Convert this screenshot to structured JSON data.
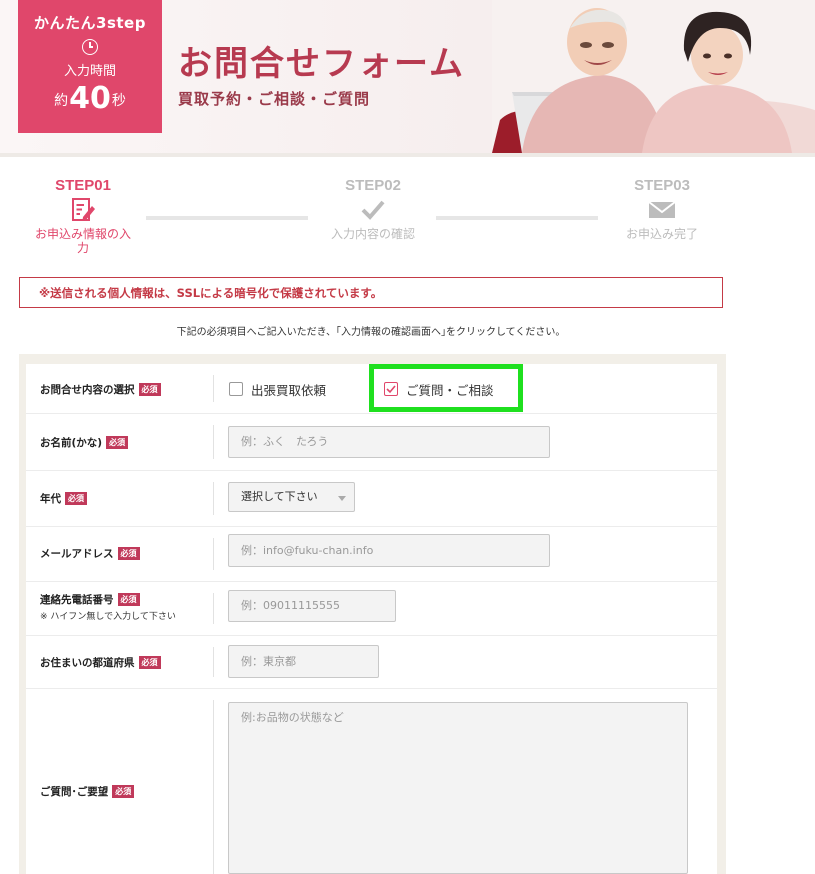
{
  "header": {
    "badge": {
      "steps": "かんたん3step",
      "input_time_label": "入力時間",
      "duration_prefix": "約",
      "duration_value": "40",
      "duration_suffix": "秒"
    },
    "title": "お問合せフォーム",
    "subtitle": "買取予約・ご相談・ご質問"
  },
  "steps": [
    {
      "label": "STEP01",
      "desc": "お申込み情報の入力",
      "status": "active",
      "icon": "edit-icon"
    },
    {
      "label": "STEP02",
      "desc": "入力内容の確認",
      "status": "inactive",
      "icon": "check-icon"
    },
    {
      "label": "STEP03",
      "desc": "お申込み完了",
      "status": "inactive",
      "icon": "mail-icon"
    }
  ],
  "notice": "※送信される個人情報は、SSLによる暗号化で保護されています。",
  "instruction": "下記の必須項目へご記入いただき、｢入力情報の確認画面へ｣をクリックしてください。",
  "required_badge": "必須",
  "form": {
    "inquiry_type": {
      "label": "お問合せ内容の選択",
      "options": [
        {
          "label": "出張買取依頼",
          "checked": false
        },
        {
          "label": "ご質問・ご相談",
          "checked": true
        }
      ]
    },
    "name_kana": {
      "label": "お名前(かな)",
      "placeholder": "例：ふく　たろう"
    },
    "age": {
      "label": "年代",
      "selected": "選択して下さい"
    },
    "email": {
      "label": "メールアドレス",
      "placeholder": "例：info@fuku-chan.info"
    },
    "phone": {
      "label": "連絡先電話番号",
      "note": "※ ハイフン無しで入力して下さい",
      "placeholder": "例：09011115555"
    },
    "prefecture": {
      "label": "お住まいの都道府県",
      "placeholder": "例：東京都"
    },
    "message": {
      "label": "ご質問･ご要望",
      "placeholder": "例:お品物の状態など"
    }
  },
  "colors": {
    "accent": "#e0476b",
    "title": "#b73a50",
    "notice": "#c43a46",
    "highlight": "#1fe01f",
    "inactive": "#bcbcbc"
  }
}
